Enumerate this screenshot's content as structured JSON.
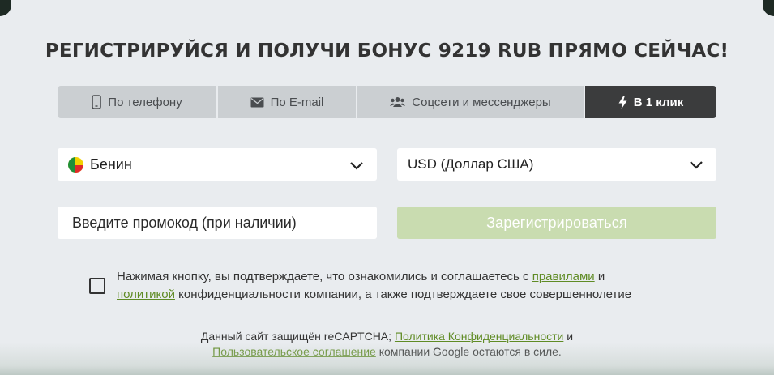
{
  "title": "РЕГИСТРИРУЙСЯ И ПОЛУЧИ БОНУС 9219 RUB ПРЯМО СЕЙЧАС!",
  "tabs": [
    {
      "label": "По телефону",
      "icon": "phone-icon",
      "active": false
    },
    {
      "label": "По E-mail",
      "icon": "envelope-icon",
      "active": false
    },
    {
      "label": "Соцсети и мессенджеры",
      "icon": "users-icon",
      "active": false
    },
    {
      "label": "В 1 клик",
      "icon": "lightning-icon",
      "active": true
    }
  ],
  "country": {
    "value": "Бенин",
    "flag": "benin-flag-icon"
  },
  "currency": {
    "value": "USD (Доллар США)"
  },
  "promo": {
    "placeholder": "Введите промокод (при наличии)"
  },
  "register_button": {
    "label": "Зарегистрироваться",
    "color": "#c9dcb0"
  },
  "consent": {
    "before_rules": "Нажимая кнопку, вы подтверждаете, что ознакомились и соглашаетесь с ",
    "rules_link": "правилами",
    "and": " и",
    "privacy_link": "политикой",
    "after_privacy": " конфиденциальности компании, а также подтверждаете свое совершеннолетие",
    "checked": false
  },
  "recaptcha": {
    "prefix": "Данный сайт защищён reCAPTCHA; ",
    "privacy_link": "Политика Конфиденциальности",
    "and": " и",
    "terms_link": "Пользовательское соглашение",
    "suffix": " компании Google остаются в силе."
  },
  "colors": {
    "accent_link": "#5f8b24",
    "active_tab": "#3b3c3d",
    "inactive_tab": "#cbcfd2",
    "panel": "#e9ecef"
  }
}
